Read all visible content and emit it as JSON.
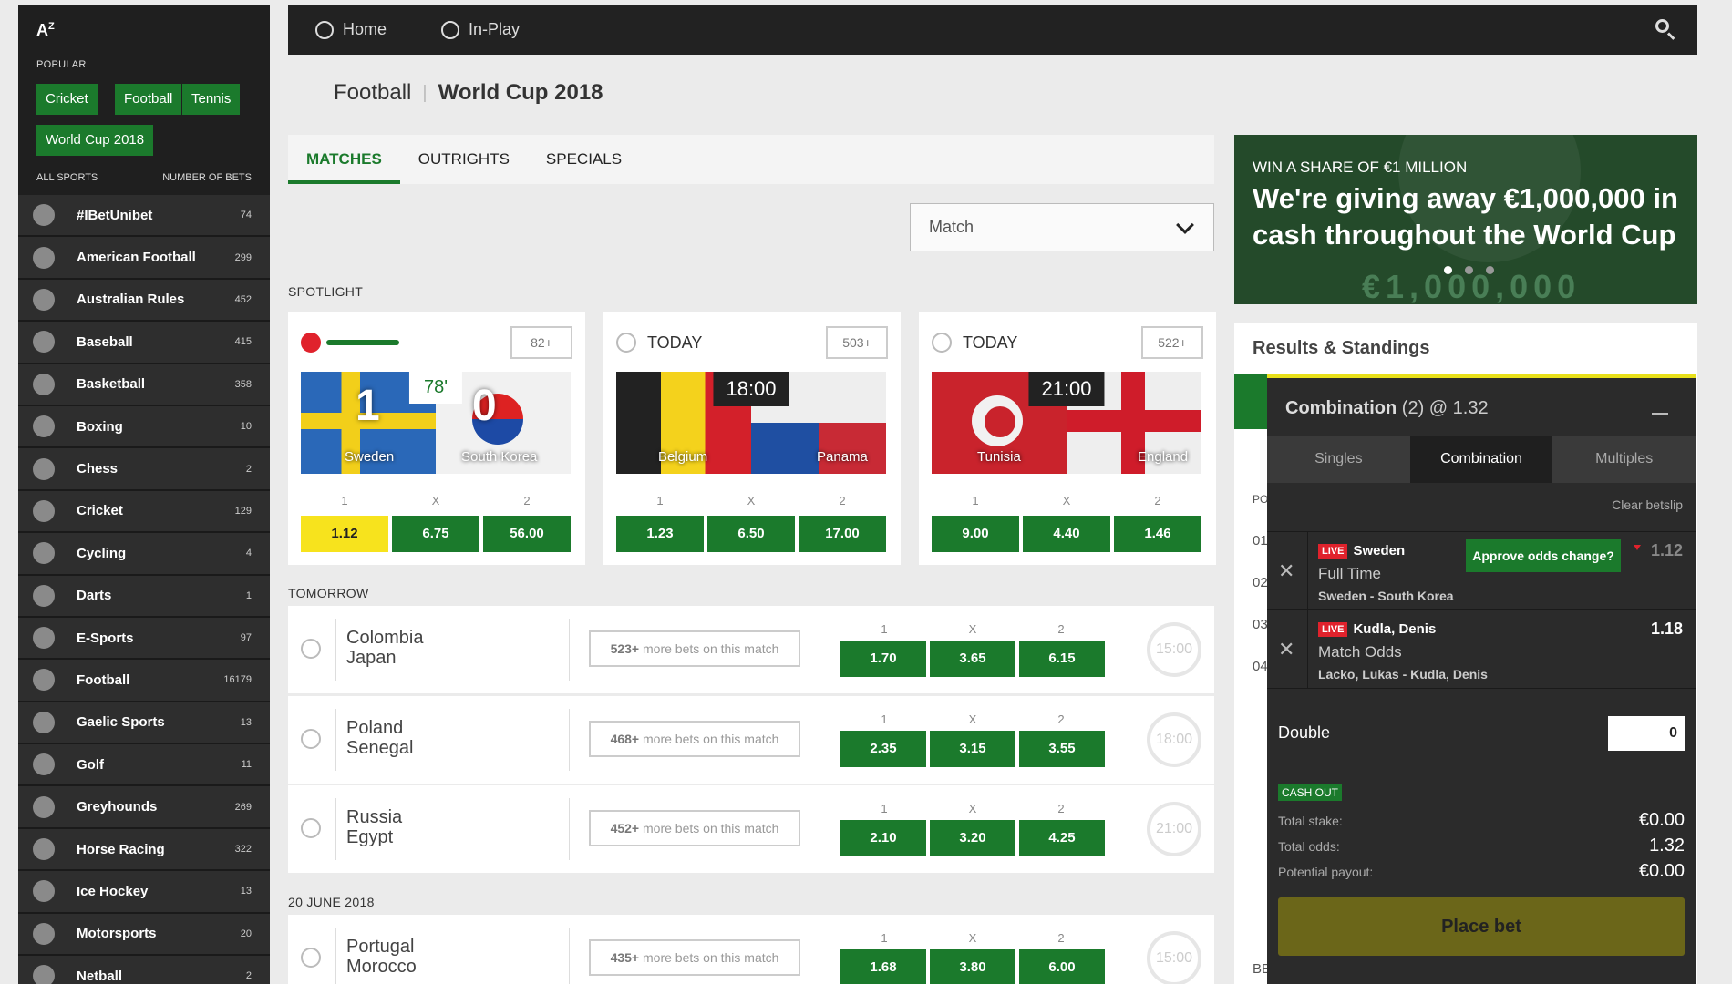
{
  "sidebar": {
    "az_label": "A",
    "az_sub": "Z",
    "popular_label": "POPULAR",
    "popular": [
      "Cricket",
      "Football",
      "Tennis",
      "World Cup 2018"
    ],
    "all_sports_label": "ALL SPORTS",
    "number_of_bets_label": "NUMBER OF BETS",
    "sports": [
      {
        "name": "#IBetUnibet",
        "count": "74"
      },
      {
        "name": "American Football",
        "count": "299"
      },
      {
        "name": "Australian Rules",
        "count": "452"
      },
      {
        "name": "Baseball",
        "count": "415"
      },
      {
        "name": "Basketball",
        "count": "358"
      },
      {
        "name": "Boxing",
        "count": "10"
      },
      {
        "name": "Chess",
        "count": "2"
      },
      {
        "name": "Cricket",
        "count": "129"
      },
      {
        "name": "Cycling",
        "count": "4"
      },
      {
        "name": "Darts",
        "count": "1"
      },
      {
        "name": "E-Sports",
        "count": "97"
      },
      {
        "name": "Football",
        "count": "16179"
      },
      {
        "name": "Gaelic Sports",
        "count": "13"
      },
      {
        "name": "Golf",
        "count": "11"
      },
      {
        "name": "Greyhounds",
        "count": "269"
      },
      {
        "name": "Horse Racing",
        "count": "322"
      },
      {
        "name": "Ice Hockey",
        "count": "13"
      },
      {
        "name": "Motorsports",
        "count": "20"
      },
      {
        "name": "Netball",
        "count": "2"
      }
    ]
  },
  "topbar": {
    "home": "Home",
    "inplay": "In-Play"
  },
  "breadcrumb": {
    "part1": "Football",
    "sep": "|",
    "part2": "World Cup 2018"
  },
  "tabs": [
    "MATCHES",
    "OUTRIGHTS",
    "SPECIALS"
  ],
  "select": {
    "value": "Match"
  },
  "spotlight_label": "SPOTLIGHT",
  "spotlight": [
    {
      "day": "",
      "more": "82+",
      "team1": "Sweden",
      "team2": "South Korea",
      "score1": "1",
      "score2": "0",
      "center": "78'",
      "odds": [
        "1.12",
        "6.75",
        "56.00"
      ]
    },
    {
      "day": "TODAY",
      "more": "503+",
      "team1": "Belgium",
      "team2": "Panama",
      "center": "18:00",
      "odds": [
        "1.23",
        "6.50",
        "17.00"
      ]
    },
    {
      "day": "TODAY",
      "more": "522+",
      "team1": "Tunisia",
      "team2": "England",
      "center": "21:00",
      "odds": [
        "9.00",
        "4.40",
        "1.46"
      ]
    }
  ],
  "odds_heads": [
    "1",
    "X",
    "2"
  ],
  "tomorrow_label": "TOMORROW",
  "june_label": "20 JUNE 2018",
  "more_bets_suffix": "more bets on this match",
  "matches": [
    {
      "team1": "Colombia",
      "team2": "Japan",
      "more": "523+",
      "odds": [
        "1.70",
        "3.65",
        "6.15"
      ],
      "time": "15:00"
    },
    {
      "team1": "Poland",
      "team2": "Senegal",
      "more": "468+",
      "odds": [
        "2.35",
        "3.15",
        "3.55"
      ],
      "time": "18:00"
    },
    {
      "team1": "Russia",
      "team2": "Egypt",
      "more": "452+",
      "odds": [
        "2.10",
        "3.20",
        "4.25"
      ],
      "time": "21:00"
    },
    {
      "team1": "Portugal",
      "team2": "Morocco",
      "more": "435+",
      "odds": [
        "1.68",
        "3.80",
        "6.00"
      ],
      "time": "15:00"
    }
  ],
  "promo": {
    "kicker": "WIN A SHARE OF €1 MILLION",
    "headline": "We're giving away €1,000,000 in cash throughout the World Cup",
    "amount": "€1,000,000"
  },
  "results": {
    "title": "Results & Standings",
    "rows": [
      "01",
      "02",
      "03",
      "04"
    ],
    "po": "PO",
    "be": "BE"
  },
  "betslip": {
    "title": "Combination",
    "count": "(2)",
    "at": "@ 1.32",
    "tabs": [
      "Singles",
      "Combination",
      "Multiples"
    ],
    "clear": "Clear betslip",
    "live_label": "LIVE",
    "selections": [
      {
        "team": "Sweden",
        "market": "Full Time",
        "event": "Sweden - South Korea",
        "price": "1.12",
        "approve": "Approve odds change?"
      },
      {
        "team": "Kudla, Denis",
        "market": "Match Odds",
        "event": "Lacko, Lukas - Kudla, Denis",
        "price": "1.18"
      }
    ],
    "double_label": "Double",
    "double_stake": "0",
    "cashout": "CASH OUT",
    "total_stake_label": "Total stake:",
    "total_stake": "€0.00",
    "total_odds_label": "Total odds:",
    "total_odds": "1.32",
    "payout_label": "Potential payout:",
    "payout": "€0.00",
    "place": "Place bet"
  }
}
